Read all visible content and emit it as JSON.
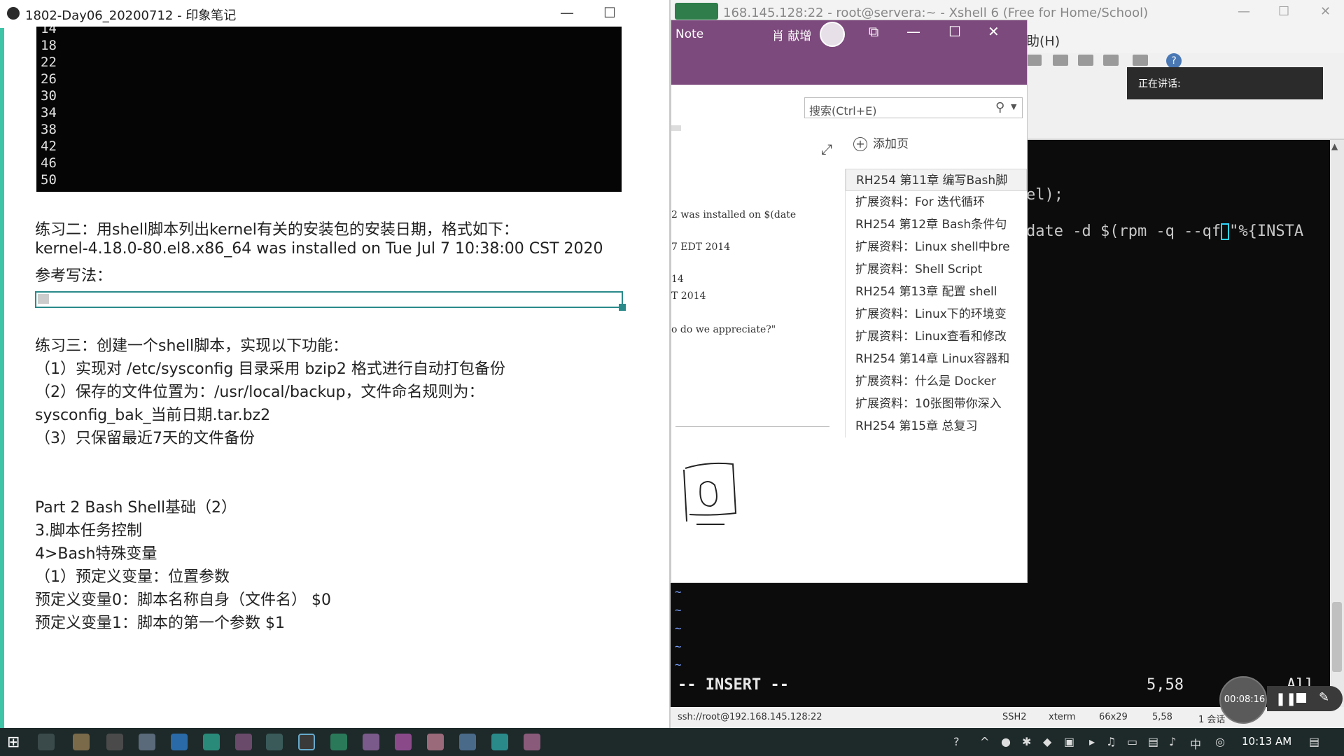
{
  "xshell": {
    "title": "168.145.128:22 - root@servera:~ - Xshell 6 (Free for Home/School)",
    "menu_help": "助(H)",
    "session_label": "正在讲话:",
    "term_line1": "el);",
    "term_line2_prefix": "date -d $(rpm -q --qf",
    "term_line2_suffix": "\"%{INSTA",
    "insert_mode": "-- INSERT --",
    "cursor_pos": "5,58",
    "scroll_pos": "All",
    "status": {
      "ssh_url": "ssh://root@192.168.145.128:22",
      "protocol": "SSH2",
      "term_type": "xterm",
      "size": "66x29",
      "pos": "5,58",
      "sessions": "1 会话"
    }
  },
  "recorder": {
    "time": "00:08:16"
  },
  "onenote": {
    "app_name": "Note",
    "user_name": "肖 献增",
    "search_placeholder": "搜索(Ctrl+E)",
    "add_page": "添加页",
    "pages": [
      "RH254 第11章 编写Bash脚",
      "扩展资料：For 迭代循环",
      "RH254 第12章 Bash条件句",
      "扩展资料：Linux shell中bre",
      "扩展资料：Shell Script",
      "RH254 第13章 配置 shell",
      "扩展资料：Linux下的环境变",
      "扩展资料：Linux查看和修改",
      "RH254 第14章 Linux容器和",
      "扩展资料：什么是 Docker",
      "扩展资料：10张图带你深入",
      "RH254 第15章 总复习"
    ],
    "snippets": [
      "2 was installed on $(date",
      "7 EDT 2014",
      "14",
      "T 2014",
      "o do we appreciate?\""
    ]
  },
  "evernote": {
    "title": "1802-Day06_20200712 - 印象笔记",
    "numbers": [
      "14",
      "18",
      "22",
      "26",
      "30",
      "34",
      "38",
      "42",
      "46",
      "50"
    ],
    "lines": [
      "练习二：用shell脚本列出kernel有关的安装包的安装日期，格式如下：",
      "kernel-4.18.0-80.el8.x86_64 was installed on Tue Jul 7 10:38:00 CST 2020",
      "参考写法：",
      "练习三：创建一个shell脚本，实现以下功能：",
      "（1）实现对 /etc/sysconfig 目录采用 bzip2 格式进行自动打包备份",
      "（2）保存的文件位置为：/usr/local/backup，文件命名规则为：",
      "sysconfig_bak_当前日期.tar.bz2",
      "（3）只保留最近7天的文件备份",
      "Part 2 Bash Shell基础（2）",
      "3.脚本任务控制",
      "4>Bash特殊变量",
      "（1）预定义变量：位置参数",
      "预定义变量0：脚本名称自身（文件名）  $0",
      "预定义变量1：脚本的第一个参数  $1"
    ]
  },
  "taskbar": {
    "clock": "10:13 AM"
  }
}
